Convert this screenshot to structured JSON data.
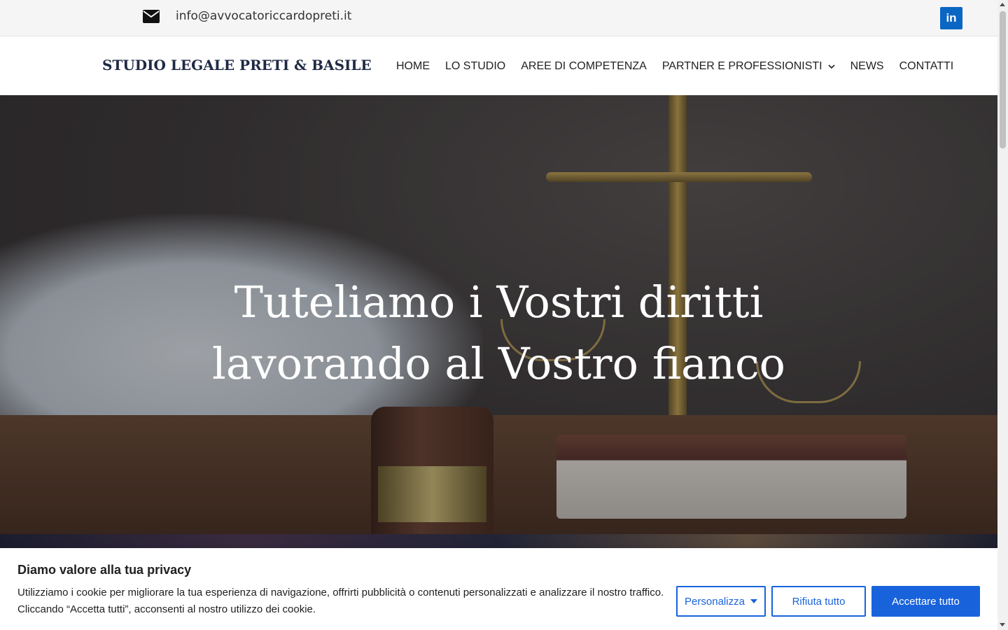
{
  "topbar": {
    "email": "info@avvocatoriccardopreti.it",
    "email_icon": "envelope-icon",
    "social_icon": "linkedin-icon",
    "social_label": "in"
  },
  "header": {
    "logo": "STUDIO LEGALE PRETI & BASILE",
    "nav": [
      {
        "label": "HOME"
      },
      {
        "label": "LO STUDIO"
      },
      {
        "label": "AREE DI COMPETENZA"
      },
      {
        "label": "PARTNER E PROFESSIONISTI",
        "has_dropdown": true
      },
      {
        "label": "NEWS"
      },
      {
        "label": "CONTATTI"
      }
    ]
  },
  "hero": {
    "line1": "Tuteliamo i Vostri diritti",
    "line2": "lavorando al Vostro fianco"
  },
  "cookie": {
    "title": "Diamo valore alla tua privacy",
    "text_line1": "Utilizziamo i cookie per migliorare la tua esperienza di navigazione, offrirti pubblicità o contenuti personalizzati e analizzare il nostro traffico.",
    "text_line2": "Cliccando “Accetta tutti”, acconsenti al nostro utilizzo dei cookie.",
    "customize_label": "Personalizza",
    "reject_label": "Rifiuta tutto",
    "accept_label": "Accettare tutto"
  },
  "colors": {
    "accent": "#1863dc",
    "linkedin": "#0a66c2",
    "logo": "#1f2a44"
  }
}
